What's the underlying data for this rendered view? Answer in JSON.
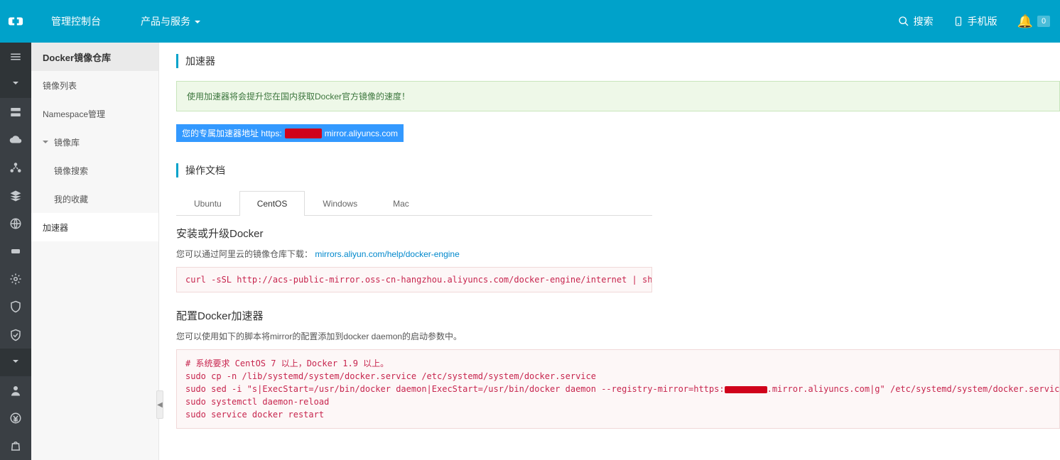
{
  "topbar": {
    "console": "管理控制台",
    "products": "产品与服务",
    "search": "搜索",
    "mobile": "手机版",
    "notif_count": "0"
  },
  "sidebar": {
    "title": "Docker镜像仓库",
    "items": {
      "list": "镜像列表",
      "ns": "Namespace管理",
      "lib": "镜像库",
      "search": "镜像搜索",
      "fav": "我的收藏",
      "acc": "加速器"
    }
  },
  "page": {
    "title": "加速器",
    "alert": "使用加速器将会提升您在国内获取Docker官方镜像的速度！",
    "pill_pre": "您的专属加速器地址 https:",
    "pill_hidden": "xxxxxxxx",
    "pill_post": "mirror.aliyuncs.com",
    "docs_title": "操作文档",
    "tabs": {
      "ubuntu": "Ubuntu",
      "centos": "CentOS",
      "windows": "Windows",
      "mac": "Mac"
    },
    "h_install": "安装或升级Docker",
    "p_install_pre": "您可以通过阿里云的镜像仓库下载：",
    "p_install_link": "mirrors.aliyun.com/help/docker-engine",
    "code_install": "curl -sSL http://acs-public-mirror.oss-cn-hangzhou.aliyuncs.com/docker-engine/internet | sh -",
    "h_cfg": "配置Docker加速器",
    "p_cfg": "您可以使用如下的脚本将mirror的配置添加到docker daemon的启动参数中。",
    "code_cfg_line1": "# 系统要求 CentOS 7 以上，Docker 1.9 以上。",
    "code_cfg_line2": "sudo cp -n /lib/systemd/system/docker.service /etc/systemd/system/docker.service",
    "code_cfg_line3a": "sudo sed -i \"s|ExecStart=/usr/bin/docker daemon|ExecStart=/usr/bin/docker daemon --registry-mirror=https:",
    "code_cfg_line3b": ".mirror.aliyuncs.com|g\" /etc/systemd/system/docker.service",
    "code_cfg_line4": "sudo systemctl daemon-reload",
    "code_cfg_line5": "sudo service docker restart"
  }
}
